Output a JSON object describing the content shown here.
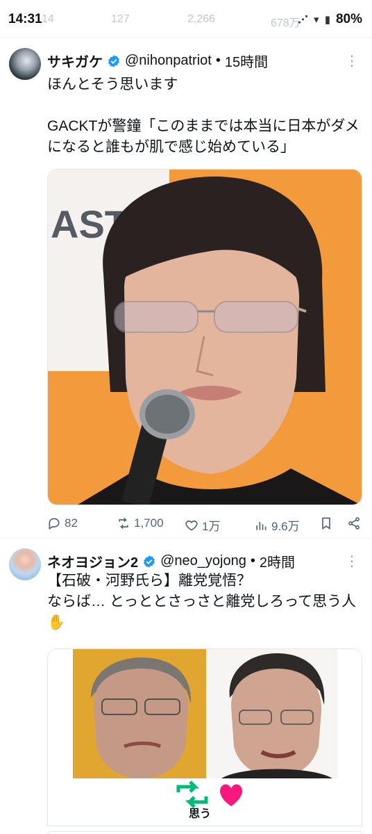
{
  "status_bar": {
    "time": "14:31",
    "battery": "80%",
    "icons": "⋰ ▾ ▮"
  },
  "bleed_metrics": {
    "replies": "14",
    "reposts": "127",
    "likes": "2,266",
    "views": "678万"
  },
  "tweet1": {
    "name": "サキガケ",
    "handle": "@nihonpatriot",
    "time": "15時間",
    "text": "ほんとそう思います\n\nGACKTが警鐘「このままでは本当に日本がダメになると誰もが肌で感じ始めている」",
    "backdrop_text": "AST   LCA",
    "actions": {
      "replies": "82",
      "reposts": "1,700",
      "likes": "1万",
      "views": "9.6万"
    }
  },
  "tweet2": {
    "name": "ネオヨジョン2",
    "handle": "@neo_yojong",
    "time": "2時間",
    "text": "【石破・河野氏ら】離党覚悟？\nならば… とっととさっさと離党しろって思う人✋",
    "caption": "思う"
  },
  "colors": {
    "verified": "#1d9bf0",
    "repost_green": "#00ba7c",
    "like_red": "#f91880",
    "muted": "#536471"
  }
}
